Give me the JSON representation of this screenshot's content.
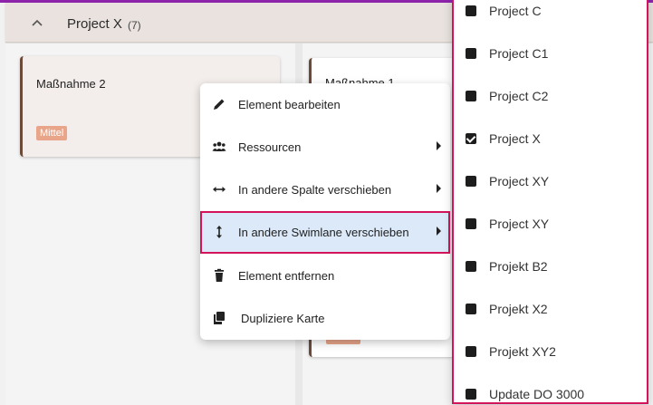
{
  "swimlane": {
    "title": "Project X",
    "count": "(7)"
  },
  "cards": [
    {
      "title": "Maßnahme 2",
      "priority": "Mittel"
    },
    {
      "title": "Maßnahme 1",
      "priority": ""
    }
  ],
  "context_menu": {
    "items": [
      {
        "label": "Element bearbeiten",
        "icon": "pencil-icon",
        "has_submenu": false
      },
      {
        "label": "Ressourcen",
        "icon": "people-icon",
        "has_submenu": true
      },
      {
        "label": "In andere Spalte verschieben",
        "icon": "horizontal-arrows-icon",
        "has_submenu": true
      },
      {
        "label": "In andere Swimlane verschieben",
        "icon": "vertical-arrows-icon",
        "has_submenu": true,
        "active": true
      },
      {
        "label": "Element entfernen",
        "icon": "trash-icon",
        "has_submenu": false
      },
      {
        "label": "Dupliziere Karte",
        "icon": "copy-icon",
        "has_submenu": false
      }
    ]
  },
  "submenu": {
    "items": [
      {
        "label": "Project C",
        "checked": false
      },
      {
        "label": "Project C1",
        "checked": false
      },
      {
        "label": "Project C2",
        "checked": false
      },
      {
        "label": "Project X",
        "checked": true
      },
      {
        "label": "Project XY",
        "checked": false
      },
      {
        "label": "Project XY",
        "checked": false
      },
      {
        "label": "Projekt B2",
        "checked": false
      },
      {
        "label": "Projekt X2",
        "checked": false
      },
      {
        "label": "Projekt XY2",
        "checked": false
      },
      {
        "label": "Update DO 3000",
        "checked": false
      }
    ]
  },
  "colors": {
    "accent_top": "#8e24aa",
    "highlight_border": "#d3145a",
    "active_bg": "#dbe9f9",
    "priority_badge": "#e8a58a"
  }
}
